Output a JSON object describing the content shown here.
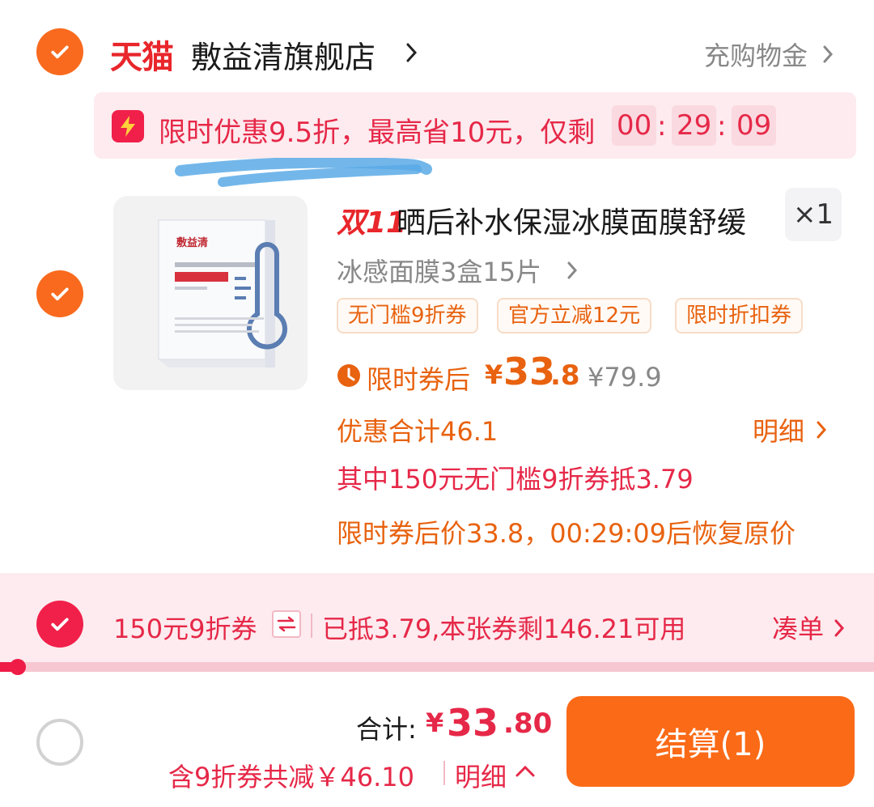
{
  "store": {
    "logo_text": "天猫",
    "name": "敷益清旗舰店",
    "recharge_label": "充购物金"
  },
  "promo": {
    "text": "限时优惠9.5折，最高省10元，仅剩",
    "timer_h": "00",
    "timer_m": "29",
    "timer_s": "09",
    "separator": ":"
  },
  "product": {
    "event_badge": "双11",
    "title": "晒后补水保湿冰膜面膜舒缓",
    "quantity": "×1",
    "sku": "冰感面膜3盒15片",
    "tags": [
      "无门槛9折券",
      "官方立减12元",
      "限时折扣券"
    ],
    "price_label": "限时券后",
    "price_currency": "¥",
    "price_integer": "33",
    "price_decimal": ".8",
    "original_price": "¥79.9",
    "discount_total": "优惠合计46.1",
    "detail_label": "明细",
    "coupon_detail": "其中150元无门槛9折券抵3.79",
    "restore_note": "限时券后价33.8，00:29:09后恢复原价",
    "image_brand": "敷益清"
  },
  "coupon": {
    "name": "150元9折券",
    "used_text": "已抵3.79,本张券剩146.21可用",
    "gather_label": "凑单",
    "progress": 0.02
  },
  "footer": {
    "total_label": "合计:",
    "total_currency": "¥",
    "total_integer": "33",
    "total_decimal": ".80",
    "savings_text": "含9折券共减￥46.10",
    "detail_label": "明细",
    "checkout_label": "结算(1)"
  },
  "colors": {
    "accent_orange": "#fb6a17",
    "accent_red": "#e62848",
    "tmall_red": "#e8262b"
  }
}
